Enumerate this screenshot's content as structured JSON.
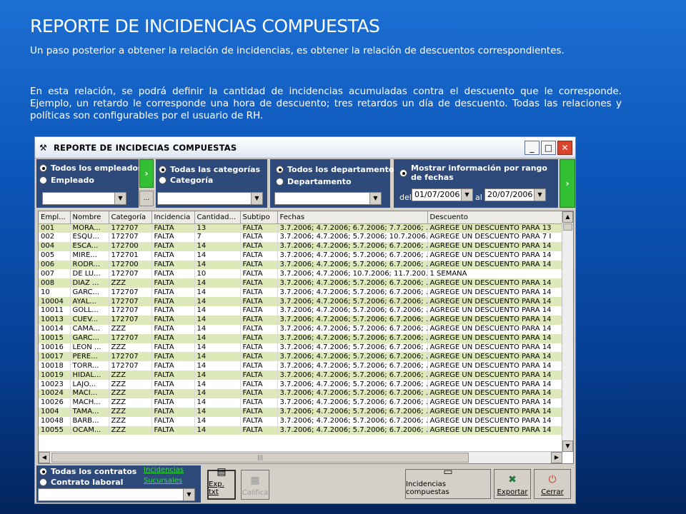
{
  "slide": {
    "title": "REPORTE DE INCIDENCIAS COMPUESTAS",
    "paragraph1": "Un paso posterior a obtener la relación de incidencias, es obtener la relación de descuentos correspondientes.",
    "paragraph2": "En esta relación,  se podrá definir la cantidad de incidencias acumuladas contra el descuento que le corresponde. Ejemplo, un retardo le corresponde una hora de descuento; tres retardos un día de descuento. Todas las relaciones y políticas son configurables por el usuario de RH."
  },
  "window": {
    "title": "REPORTE DE INCIDECIAS COMPUESTAS",
    "minimize": "_",
    "maximize": "□",
    "close": "✕"
  },
  "filters": {
    "empleados": {
      "all": "Todos los empleados",
      "one": "Empleado"
    },
    "categorias": {
      "all": "Todas las categorías",
      "one": "Categoría"
    },
    "departamentos": {
      "all": "Todos los departamentos",
      "one": "Departamento"
    },
    "fechas": {
      "label": "Mostrar información por rango de fechas",
      "del_label": "del",
      "al_label": "al",
      "from": "01/07/2006",
      "to": "20/07/2006"
    },
    "go1": "›",
    "go2": "›",
    "dots": "..."
  },
  "table": {
    "headers": [
      "Empl...",
      "Nombre",
      "Categoría",
      "Incidencia",
      "Cantidad...",
      "Subtipo",
      "Fechas",
      "Descuento"
    ],
    "rows": [
      [
        "001",
        "MORA...",
        "172707",
        "FALTA",
        "13",
        "FALTA",
        "3.7.2006; 4.7.2006; 6.7.2006; 7.7.2006; ...",
        "AGREGE UN DESCUENTO PARA 13"
      ],
      [
        "002",
        "ESQU...",
        "172707",
        "FALTA",
        "7",
        "FALTA",
        "3.7.2006; 4.7.2006; 5.7.2006; 10.7.2006...",
        "AGREGE UN DESCUENTO PARA 7 I"
      ],
      [
        "004",
        "ESCA...",
        "172700",
        "FALTA",
        "14",
        "FALTA",
        "3.7.2006; 4.7.2006; 5.7.2006; 6.7.2006; ...",
        "AGREGE UN DESCUENTO PARA 14"
      ],
      [
        "005",
        "MIRE...",
        "172701",
        "FALTA",
        "14",
        "FALTA",
        "3.7.2006; 4.7.2006; 5.7.2006; 6.7.2006; ...",
        "AGREGE UN DESCUENTO PARA 14"
      ],
      [
        "006",
        "RODR...",
        "172700",
        "FALTA",
        "14",
        "FALTA",
        "3.7.2006; 4.7.2006; 5.7.2006; 6.7.2006; ...",
        "AGREGE UN DESCUENTO PARA 14"
      ],
      [
        "007",
        "DE LU...",
        "172707",
        "FALTA",
        "10",
        "FALTA",
        "3.7.2006; 4.7.2006; 10.7.2006; 11.7.200...",
        "1 SEMANA"
      ],
      [
        "008",
        "DIAZ ...",
        "ZZZ",
        "FALTA",
        "14",
        "FALTA",
        "3.7.2006; 4.7.2006; 5.7.2006; 6.7.2006; ...",
        "AGREGE UN DESCUENTO PARA 14"
      ],
      [
        "10",
        "GARC...",
        "172707",
        "FALTA",
        "14",
        "FALTA",
        "3.7.2006; 4.7.2006; 5.7.2006; 6.7.2006; ...",
        "AGREGE UN DESCUENTO PARA 14"
      ],
      [
        "10004",
        "AYAL...",
        "172707",
        "FALTA",
        "14",
        "FALTA",
        "3.7.2006; 4.7.2006; 5.7.2006; 6.7.2006; ...",
        "AGREGE UN DESCUENTO PARA 14"
      ],
      [
        "10011",
        "GOLL...",
        "172707",
        "FALTA",
        "14",
        "FALTA",
        "3.7.2006; 4.7.2006; 5.7.2006; 6.7.2006; ...",
        "AGREGE UN DESCUENTO PARA 14"
      ],
      [
        "10013",
        "CUEV...",
        "172707",
        "FALTA",
        "14",
        "FALTA",
        "3.7.2006; 4.7.2006; 5.7.2006; 6.7.2006; ...",
        "AGREGE UN DESCUENTO PARA 14"
      ],
      [
        "10014",
        "CAMA...",
        "ZZZ",
        "FALTA",
        "14",
        "FALTA",
        "3.7.2006; 4.7.2006; 5.7.2006; 6.7.2006; ...",
        "AGREGE UN DESCUENTO PARA 14"
      ],
      [
        "10015",
        "GARC...",
        "172707",
        "FALTA",
        "14",
        "FALTA",
        "3.7.2006; 4.7.2006; 5.7.2006; 6.7.2006; ...",
        "AGREGE UN DESCUENTO PARA 14"
      ],
      [
        "10016",
        "LEON ...",
        "ZZZ",
        "FALTA",
        "14",
        "FALTA",
        "3.7.2006; 4.7.2006; 5.7.2006; 6.7.2006; ...",
        "AGREGE UN DESCUENTO PARA 14"
      ],
      [
        "10017",
        "PERE...",
        "172707",
        "FALTA",
        "14",
        "FALTA",
        "3.7.2006; 4.7.2006; 5.7.2006; 6.7.2006; ...",
        "AGREGE UN DESCUENTO PARA 14"
      ],
      [
        "10018",
        "TORR...",
        "172707",
        "FALTA",
        "14",
        "FALTA",
        "3.7.2006; 4.7.2006; 5.7.2006; 6.7.2006; ...",
        "AGREGE UN DESCUENTO PARA 14"
      ],
      [
        "10019",
        "HIDAL...",
        "ZZZ",
        "FALTA",
        "14",
        "FALTA",
        "3.7.2006; 4.7.2006; 5.7.2006; 6.7.2006; ...",
        "AGREGE UN DESCUENTO PARA 14"
      ],
      [
        "10023",
        "LAJO...",
        "ZZZ",
        "FALTA",
        "14",
        "FALTA",
        "3.7.2006; 4.7.2006; 5.7.2006; 6.7.2006; ...",
        "AGREGE UN DESCUENTO PARA 14"
      ],
      [
        "10024",
        "MACI...",
        "ZZZ",
        "FALTA",
        "14",
        "FALTA",
        "3.7.2006; 4.7.2006; 5.7.2006; 6.7.2006; ...",
        "AGREGE UN DESCUENTO PARA 14"
      ],
      [
        "10026",
        "MACH...",
        "ZZZ",
        "FALTA",
        "14",
        "FALTA",
        "3.7.2006; 4.7.2006; 5.7.2006; 6.7.2006; ...",
        "AGREGE UN DESCUENTO PARA 14"
      ],
      [
        "1004",
        "TAMA...",
        "ZZZ",
        "FALTA",
        "14",
        "FALTA",
        "3.7.2006; 4.7.2006; 5.7.2006; 6.7.2006; ...",
        "AGREGE UN DESCUENTO PARA 14"
      ],
      [
        "10048",
        "BARB...",
        "ZZZ",
        "FALTA",
        "14",
        "FALTA",
        "3.7.2006; 4.7.2006; 5.7.2006; 6.7.2006; ...",
        "AGREGE UN DESCUENTO PARA 14"
      ],
      [
        "10055",
        "OCAM...",
        "ZZZ",
        "FALTA",
        "14",
        "FALTA",
        "3.7.2006; 4.7.2006; 5.7.2006; 6.7.2006; ...",
        "AGREGE UN DESCUENTO PARA 14"
      ]
    ]
  },
  "bottom": {
    "contratos_all": "Todas los contratos",
    "contrato_laboral": "Contrato laboral",
    "link_incidencias": "Incidencias",
    "link_sucursales": "Sucursales",
    "exp_txt": "Exp. txt",
    "califica": "Califica",
    "incidencias_compuestas": "Incidencias compuestas",
    "exportar": "Exportar",
    "cerrar": "Cerrar"
  },
  "colors": {
    "row_alt": "#dde9b8",
    "filter_panel": "#2d4a7b",
    "go_button": "#34c034",
    "link": "#32e03a"
  }
}
